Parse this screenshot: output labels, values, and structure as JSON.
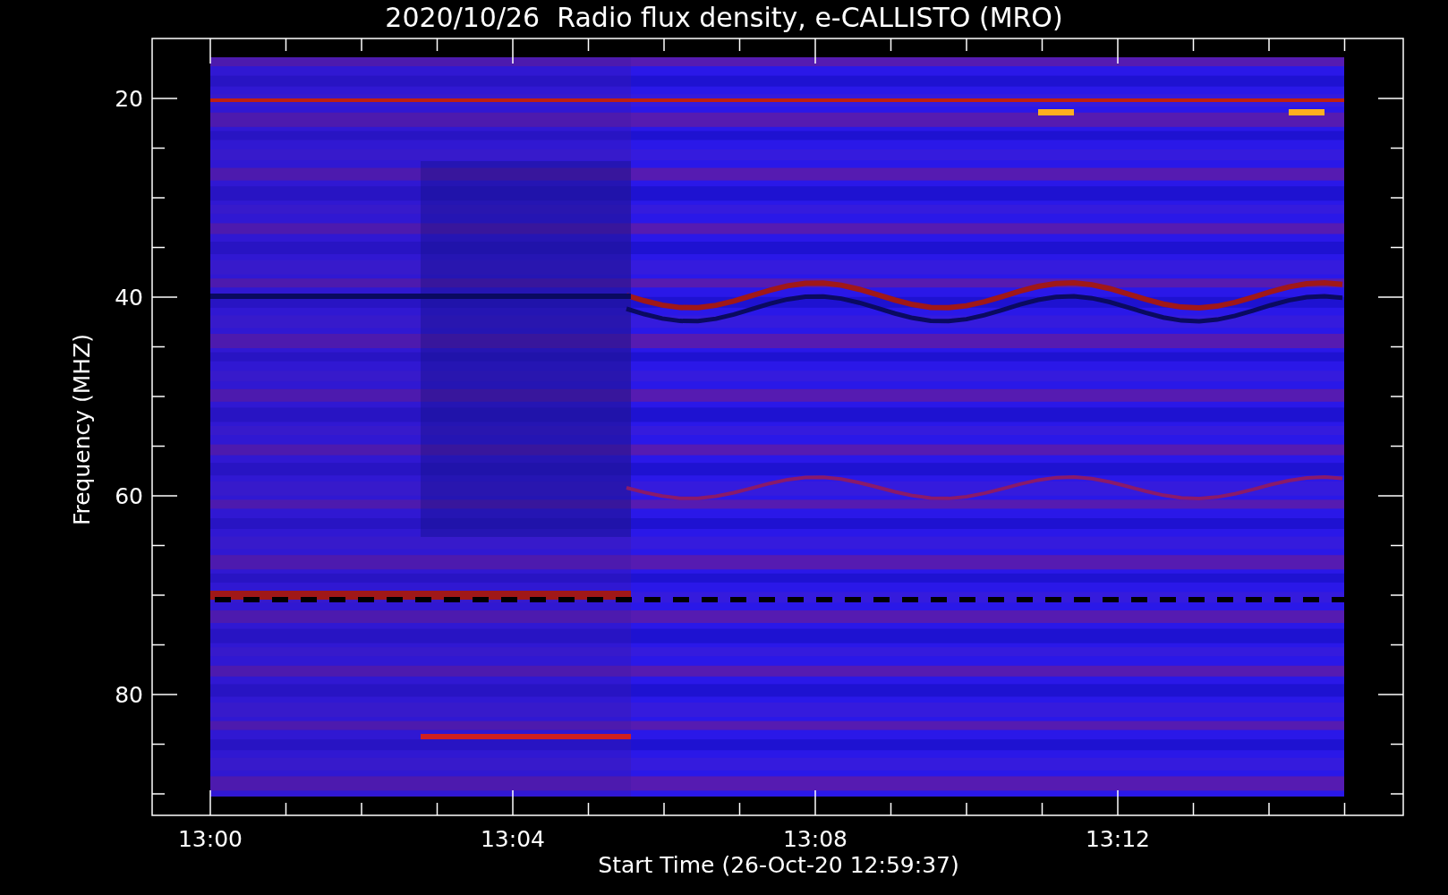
{
  "title": "2020/10/26  Radio flux density, e-CALLISTO (MRO)",
  "y_axis": {
    "label": "Frequency (MHZ)",
    "ticks": [
      "20",
      "40",
      "60",
      "80"
    ]
  },
  "x_axis": {
    "label": "Start Time (26-Oct-20 12:59:37)",
    "ticks": [
      "13:00",
      "13:04",
      "13:08",
      "13:12"
    ]
  }
}
